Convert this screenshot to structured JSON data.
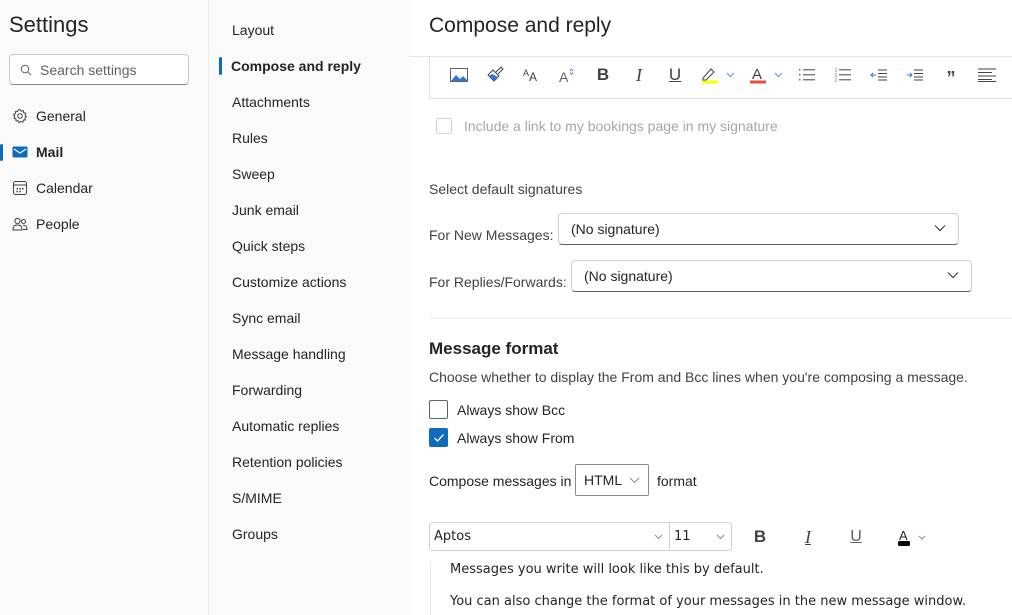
{
  "app": {
    "title": "Settings",
    "search_placeholder": "Search settings"
  },
  "categories": [
    {
      "label": "General",
      "icon": "gear-icon",
      "active": false
    },
    {
      "label": "Mail",
      "icon": "mail-icon",
      "active": true
    },
    {
      "label": "Calendar",
      "icon": "calendar-icon",
      "active": false
    },
    {
      "label": "People",
      "icon": "people-icon",
      "active": false
    }
  ],
  "subnav": [
    {
      "label": "Layout",
      "active": false
    },
    {
      "label": "Compose and reply",
      "active": true
    },
    {
      "label": "Attachments",
      "active": false
    },
    {
      "label": "Rules",
      "active": false
    },
    {
      "label": "Sweep",
      "active": false
    },
    {
      "label": "Junk email",
      "active": false
    },
    {
      "label": "Quick steps",
      "active": false
    },
    {
      "label": "Customize actions",
      "active": false
    },
    {
      "label": "Sync email",
      "active": false
    },
    {
      "label": "Message handling",
      "active": false
    },
    {
      "label": "Forwarding",
      "active": false
    },
    {
      "label": "Automatic replies",
      "active": false
    },
    {
      "label": "Retention policies",
      "active": false
    },
    {
      "label": "S/MIME",
      "active": false
    },
    {
      "label": "Groups",
      "active": false
    }
  ],
  "main": {
    "title": "Compose and reply",
    "signature_toolbar": [
      "insert-picture-icon",
      "format-painter-icon",
      "font-size-icon",
      "change-case-icon",
      "bold-icon",
      "italic-icon",
      "underline-icon",
      "highlight-icon",
      "font-color-icon",
      "bullets-icon",
      "numbering-icon",
      "decrease-indent-icon",
      "increase-indent-icon",
      "quote-icon",
      "align-icon"
    ],
    "bookings_link": {
      "label": "Include a link to my bookings page in my signature",
      "checked": false,
      "disabled": true
    },
    "default_signatures": {
      "heading": "Select default signatures",
      "new_messages_label": "For New Messages:",
      "new_messages_value": "(No signature)",
      "replies_label": "For Replies/Forwards:",
      "replies_value": "(No signature)"
    },
    "message_format": {
      "title": "Message format",
      "description": "Choose whether to display the From and Bcc lines when you're composing a message.",
      "always_show_bcc": {
        "label": "Always show Bcc",
        "checked": false
      },
      "always_show_from": {
        "label": "Always show From",
        "checked": true
      },
      "compose_prefix": "Compose messages in",
      "compose_format": "HTML",
      "compose_suffix": "format",
      "font": "Aptos",
      "font_size": "11",
      "preview_line1": "Messages you write will look like this by default.",
      "preview_line2": "You can also change the format of your messages in the new message window."
    }
  },
  "colors": {
    "accent": "#0f6cbd",
    "highlight": "#ffff00",
    "font_color": "#e74c3c"
  }
}
